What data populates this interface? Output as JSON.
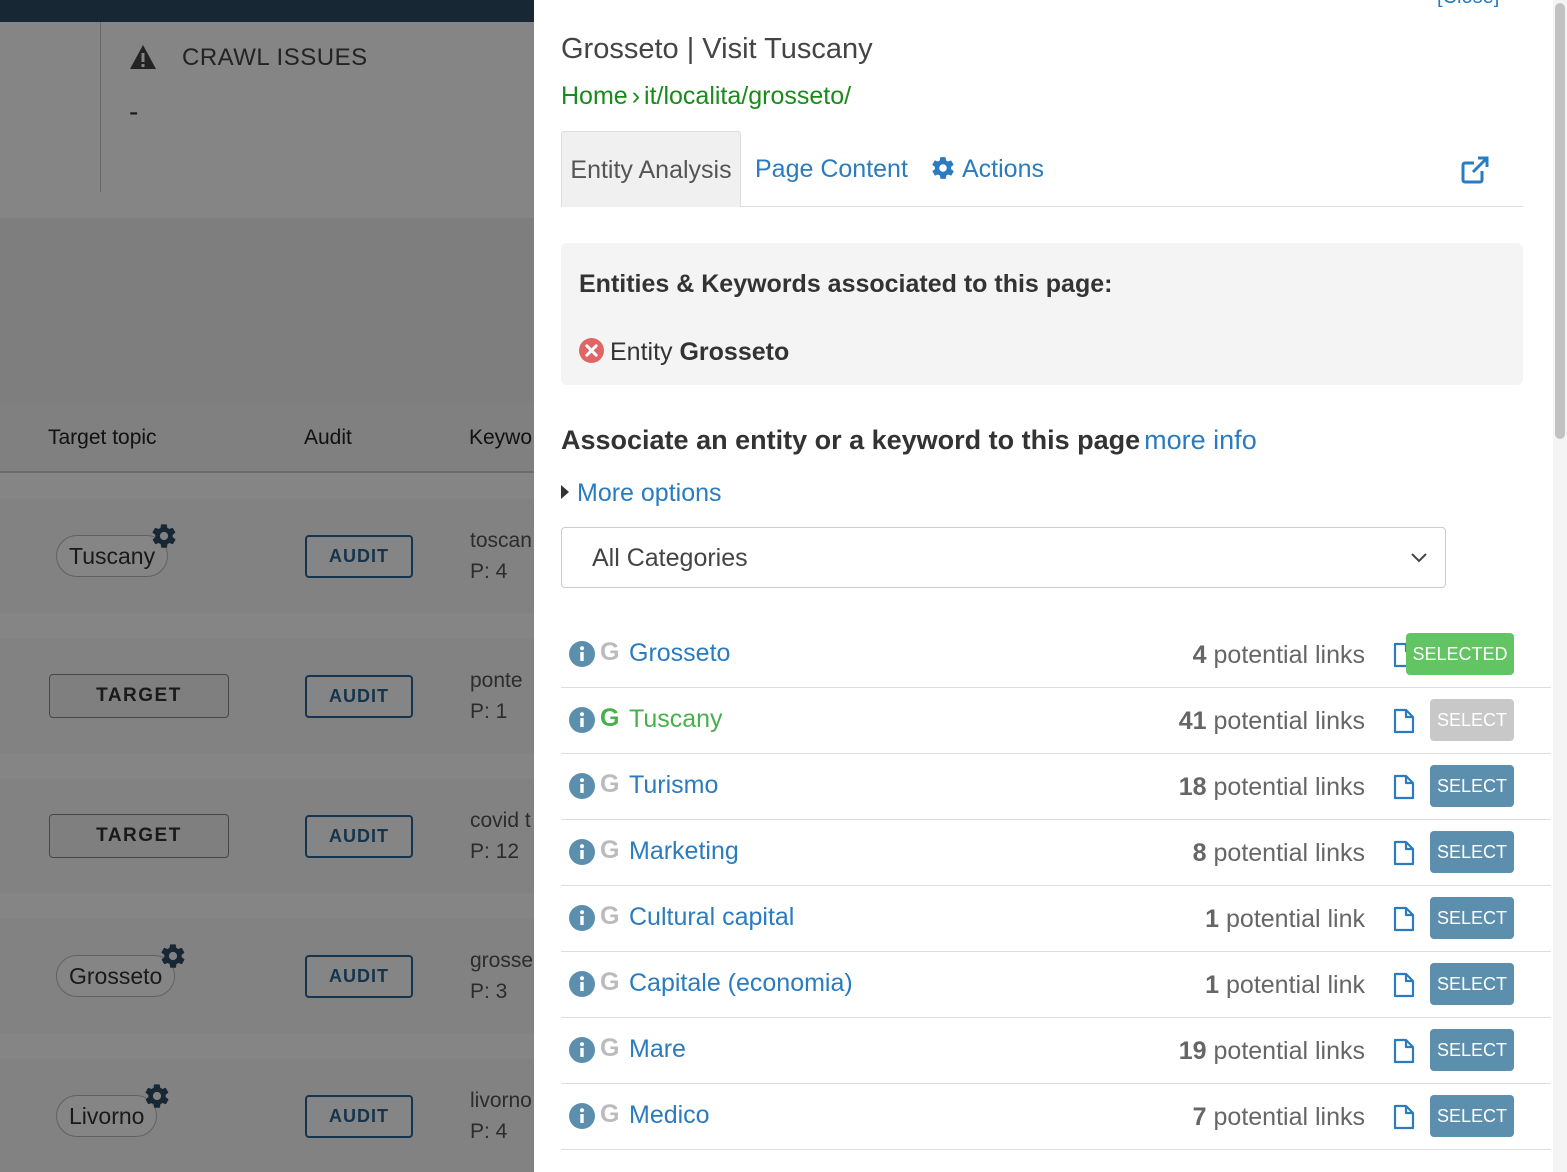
{
  "background": {
    "crawl_issues": {
      "title": "CRAWL ISSUES",
      "value": "-"
    },
    "table_headers": {
      "target_topic": "Target topic",
      "audit": "Audit",
      "keywords": "Keywo"
    },
    "rows": [
      {
        "topic": "Tuscany",
        "audit": "AUDIT",
        "keyword": "toscan",
        "p": "P: 4"
      },
      {
        "target": "TARGET",
        "audit": "AUDIT",
        "keyword": "ponte",
        "p": "P: 1"
      },
      {
        "target": "TARGET",
        "audit": "AUDIT",
        "keyword": "covid t",
        "p": "P: 12"
      },
      {
        "topic": "Grosseto",
        "audit": "AUDIT",
        "keyword": "grosse",
        "p": "P: 3"
      },
      {
        "topic": "Livorno",
        "audit": "AUDIT",
        "keyword": "livorno",
        "p": "P: 4"
      }
    ]
  },
  "panel": {
    "close_label": "[Close]",
    "title": "Grosseto | Visit Tuscany",
    "breadcrumb": {
      "home": "Home",
      "sep": "›",
      "path": "it/localita/grosseto/"
    },
    "tabs": {
      "entity_analysis": "Entity Analysis",
      "page_content": "Page Content",
      "actions": "Actions"
    },
    "associated": {
      "heading": "Entities & Keywords associated to this page:",
      "entity_prefix": "Entity",
      "entity_name": "Grosseto"
    },
    "associate_title": "Associate an entity or a keyword to this page",
    "more_info": "more info",
    "more_options": "More options",
    "category_select": "All Categories",
    "entities": [
      {
        "name": "Grosseto",
        "count": "4",
        "suffix": "potential links",
        "button": "SELECTED",
        "state": "selected",
        "google": "gray"
      },
      {
        "name": "Tuscany",
        "count": "41",
        "suffix": "potential links",
        "button": "SELECT",
        "state": "disabled",
        "google": "green"
      },
      {
        "name": "Turismo",
        "count": "18",
        "suffix": "potential links",
        "button": "SELECT",
        "state": "normal",
        "google": "gray"
      },
      {
        "name": "Marketing",
        "count": "8",
        "suffix": "potential links",
        "button": "SELECT",
        "state": "normal",
        "google": "gray"
      },
      {
        "name": "Cultural capital",
        "count": "1",
        "suffix": "potential link",
        "button": "SELECT",
        "state": "normal",
        "google": "gray"
      },
      {
        "name": "Capitale (economia)",
        "count": "1",
        "suffix": "potential link",
        "button": "SELECT",
        "state": "normal",
        "google": "gray"
      },
      {
        "name": "Mare",
        "count": "19",
        "suffix": "potential links",
        "button": "SELECT",
        "state": "normal",
        "google": "gray"
      },
      {
        "name": "Medico",
        "count": "7",
        "suffix": "potential links",
        "button": "SELECT",
        "state": "normal",
        "google": "gray"
      }
    ],
    "google_letter": "G"
  },
  "colors": {
    "link_blue": "#2a7bbf",
    "breadcrumb_green": "#1a8a1a",
    "select_button": "#5b8fad",
    "selected_button": "#62c462",
    "disabled_button": "#c8c8c8",
    "google_green": "#46b04a",
    "topbar": "#2d4b63"
  }
}
